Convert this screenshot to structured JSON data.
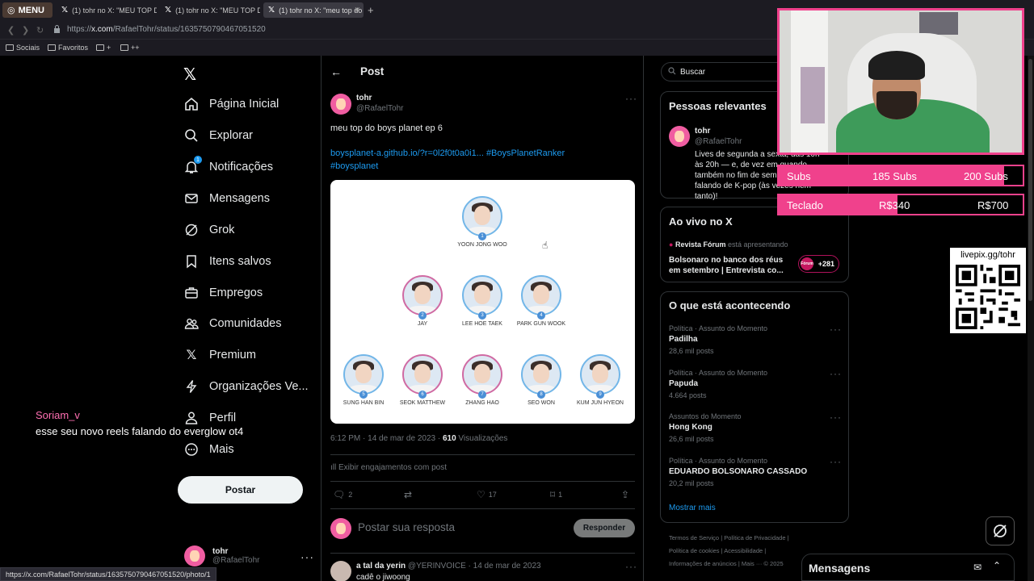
{
  "browser": {
    "menu_label": "MENU",
    "tabs": [
      {
        "label": "(1) tohr no X: \"MEU TOP D"
      },
      {
        "label": "(1) tohr no X: \"MEU TOP D"
      },
      {
        "label": "(1) tohr no X: \"meu top do"
      }
    ],
    "url_prefix": "https://",
    "url_domain": "x.com",
    "url_path": "/RafaelTohr/status/1635750790467051520",
    "bookmarks": [
      "Sociais",
      "Favoritos",
      "+",
      "++"
    ],
    "status_url": "https://x.com/RafaelTohr/status/1635750790467051520/photo/1"
  },
  "nav": {
    "items": [
      {
        "label": "Página Inicial"
      },
      {
        "label": "Explorar"
      },
      {
        "label": "Notificações",
        "badge": "1"
      },
      {
        "label": "Mensagens"
      },
      {
        "label": "Grok"
      },
      {
        "label": "Itens salvos"
      },
      {
        "label": "Empregos"
      },
      {
        "label": "Comunidades"
      },
      {
        "label": "Premium"
      },
      {
        "label": "Organizações Ve..."
      },
      {
        "label": "Perfil"
      },
      {
        "label": "Mais"
      }
    ],
    "post_button": "Postar",
    "account": {
      "name": "tohr",
      "handle": "@RafaelTohr"
    }
  },
  "chat": {
    "user": "Soriam_v",
    "message": "esse seu novo reels falando do everglow ot4"
  },
  "post": {
    "header": "Post",
    "author_name": "tohr",
    "author_handle": "@RafaelTohr",
    "text": "meu top do boys planet ep 6",
    "link_line1": "boysplanet-a.github.io/?r=0l2f0t0a0i1... #BoysPlanetRanker",
    "link_line2": "#boysplanet",
    "trainees": [
      {
        "rank": "1",
        "name": "YOON JONG WOO"
      },
      {
        "rank": "2",
        "name": "JAY"
      },
      {
        "rank": "3",
        "name": "LEE HOE TAEK"
      },
      {
        "rank": "4",
        "name": "PARK GUN WOOK"
      },
      {
        "rank": "5",
        "name": "SUNG HAN BIN"
      },
      {
        "rank": "6",
        "name": "SEOK MATTHEW"
      },
      {
        "rank": "7",
        "name": "ZHANG HAO"
      },
      {
        "rank": "8",
        "name": "SEO WON"
      },
      {
        "rank": "9",
        "name": "KUM JUN HYEON"
      }
    ],
    "timestamp": "6:12 PM · 14 de mar de 2023 · ",
    "views_count": "610",
    "views_label": " Visualizações",
    "engagements": "Exibir engajamentos com post",
    "actions": {
      "replies": "2",
      "retweets": "",
      "likes": "17",
      "bookmarks": "1"
    },
    "reply_placeholder": "Postar sua resposta",
    "reply_button": "Responder",
    "comment": {
      "name": "a tal da yerin",
      "handle": "@YERINVOICE · 14 de mar de 2023",
      "text": "cadê o jiwoong"
    }
  },
  "sidebar": {
    "search_placeholder": "Buscar",
    "relevant_title": "Pessoas relevantes",
    "relevant_name": "tohr",
    "relevant_handle": "@RafaelTohr",
    "relevant_bio": "Lives de segunda a sexta, das 10h às 20h — e, de vez em quando, também no fim de semana. Sempre falando de K-pop (às vezes nem tanto)!",
    "live_title": "Ao vivo no X",
    "live_source_name": "Revista Fórum",
    "live_source_suffix": " está apresentando",
    "live_headline": "Bolsonaro no banco dos réus em setembro | Entrevista co...",
    "live_count": "+281",
    "live_pill_logo": "Fórum",
    "trends_title": "O que está acontecendo",
    "trends": [
      {
        "category": "Política · Assunto do Momento",
        "title": "Padilha",
        "count": "28,6 mil posts"
      },
      {
        "category": "Política · Assunto do Momento",
        "title": "Papuda",
        "count": "4.664 posts"
      },
      {
        "category": "Assuntos do Momento",
        "title": "Hong Kong",
        "count": "26,6 mil posts"
      },
      {
        "category": "Política · Assunto do Momento",
        "title": "EDUARDO BOLSONARO CASSADO",
        "count": "20,2 mil posts"
      }
    ],
    "show_more": "Mostrar mais",
    "footer_line1": "Termos de Serviço  |  Política de Privacidade  |",
    "footer_line2": "Política de cookies  |  Acessibilidade  |",
    "footer_line3": "Informações de anúncios  |  Mais ···  © 2025"
  },
  "overlay": {
    "subs": {
      "label": "Subs",
      "current": "185 Subs",
      "goal": "200 Subs",
      "progress": 0.925
    },
    "teclado": {
      "label": "Teclado",
      "current": "R$340",
      "goal": "R$700",
      "progress": 0.486
    },
    "qr_label": "livepix.gg/tohr"
  },
  "messages_drawer": "Mensagens",
  "colors": {
    "accent": "#1d9bf0",
    "overlay_pink": "#f0418c",
    "background": "#000000"
  }
}
